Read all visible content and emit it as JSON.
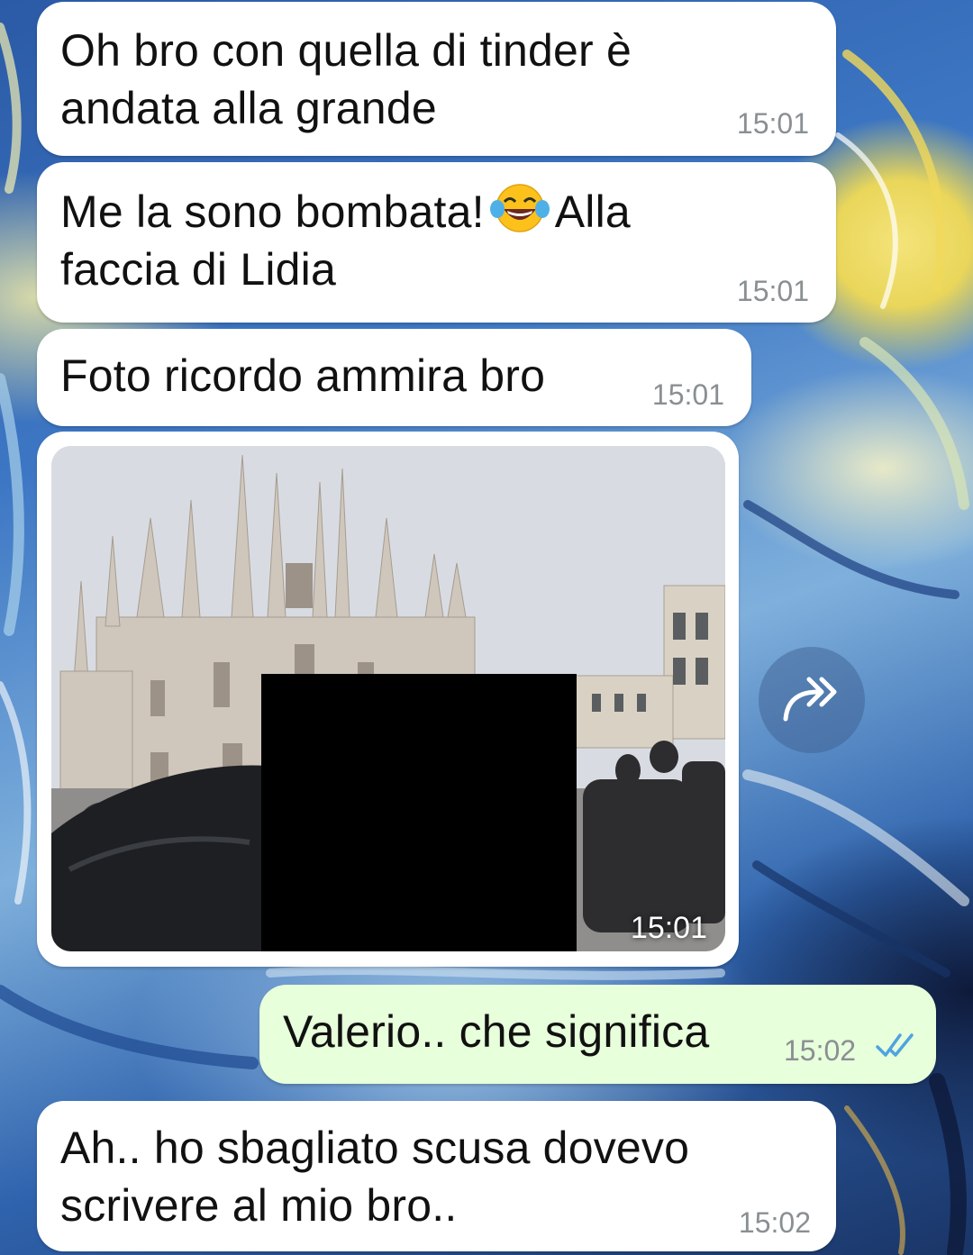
{
  "chat": {
    "messages": [
      {
        "direction": "incoming",
        "line1": "Oh bro con quella di tinder è",
        "line2": "andata alla grande",
        "time": "15:01"
      },
      {
        "direction": "incoming",
        "line1_before_emoji": "Me la sono bombata!",
        "emoji": "face-with-tears-of-joy",
        "line1_after_emoji": "Alla",
        "line2": "faccia di Lidia",
        "time": "15:01"
      },
      {
        "direction": "incoming",
        "text": "Foto ricordo ammira bro",
        "time": "15:01"
      },
      {
        "direction": "incoming",
        "type": "photo",
        "time": "15:01"
      },
      {
        "direction": "outgoing",
        "text": "Valerio.. che significa",
        "time": "15:02",
        "status": "read",
        "status_icon": "double-check-icon"
      },
      {
        "direction": "incoming",
        "line1": "Ah.. ho sbagliato scusa dovevo",
        "line2": "scrivere al mio bro..",
        "time": "15:02"
      }
    ],
    "forward_icon": "forward-icon"
  },
  "colors": {
    "incoming_bubble": "#ffffff",
    "outgoing_bubble": "#e7ffdb",
    "timestamp": "#8a8f93",
    "read_ticks": "#4fa3e0"
  }
}
